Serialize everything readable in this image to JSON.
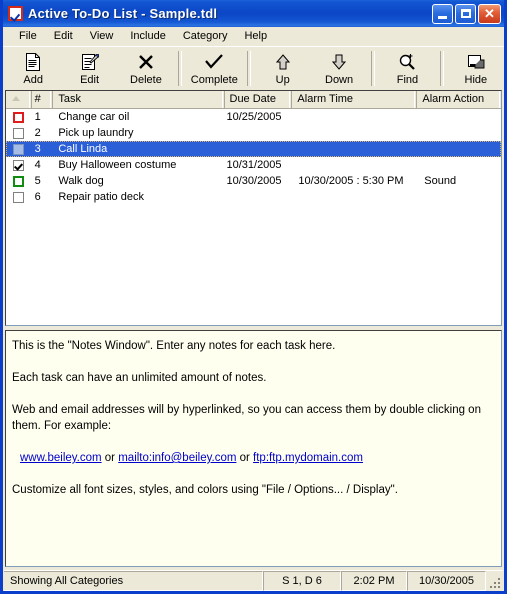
{
  "window": {
    "title": "Active To-Do List - Sample.tdl",
    "app_icon": "checkbox-icon",
    "controls": {
      "minimize_label": "",
      "maximize_label": "",
      "close_label": "✕"
    }
  },
  "menubar": {
    "items": [
      {
        "label": "File"
      },
      {
        "label": "Edit"
      },
      {
        "label": "View"
      },
      {
        "label": "Include"
      },
      {
        "label": "Category"
      },
      {
        "label": "Help"
      }
    ]
  },
  "toolbar": {
    "buttons": [
      {
        "label": "Add",
        "icon": "new-document-icon"
      },
      {
        "label": "Edit",
        "icon": "edit-document-icon"
      },
      {
        "label": "Delete",
        "icon": "x-cross-icon"
      },
      {
        "label": "Complete",
        "icon": "checkmark-icon"
      },
      {
        "label": "Up",
        "icon": "arrow-up-icon"
      },
      {
        "label": "Down",
        "icon": "arrow-down-icon"
      },
      {
        "label": "Find",
        "icon": "magnifier-icon"
      },
      {
        "label": "Hide",
        "icon": "window-minimize-icon"
      }
    ],
    "separator_after": [
      3,
      5,
      6
    ]
  },
  "task_list": {
    "columns": [
      {
        "key": "check",
        "label": "",
        "sort_indicator": "ascending"
      },
      {
        "key": "num",
        "label": "#"
      },
      {
        "key": "task",
        "label": "Task"
      },
      {
        "key": "due",
        "label": "Due Date"
      },
      {
        "key": "alarm",
        "label": "Alarm Time"
      },
      {
        "key": "action",
        "label": "Alarm Action"
      }
    ],
    "rows": [
      {
        "num": "1",
        "task": "Change car oil",
        "due": "10/25/2005",
        "alarm": "",
        "action": "",
        "checkbox": {
          "state": "unchecked",
          "color": "#e01b1b"
        },
        "selected": false
      },
      {
        "num": "2",
        "task": "Pick up laundry",
        "due": "",
        "alarm": "",
        "action": "",
        "checkbox": {
          "state": "unchecked",
          "color": "#808080"
        },
        "selected": false
      },
      {
        "num": "3",
        "task": "Call Linda",
        "due": "",
        "alarm": "",
        "action": "",
        "checkbox": {
          "state": "unchecked",
          "color": "#7a93c0"
        },
        "selected": true
      },
      {
        "num": "4",
        "task": "Buy Halloween costume",
        "due": "10/31/2005",
        "alarm": "",
        "action": "",
        "checkbox": {
          "state": "checked",
          "color": "#808080"
        },
        "selected": false
      },
      {
        "num": "5",
        "task": "Walk dog",
        "due": "10/30/2005",
        "alarm": "10/30/2005 : 5:30 PM",
        "action": "Sound",
        "checkbox": {
          "state": "unchecked",
          "color": "#108c10"
        },
        "selected": false
      },
      {
        "num": "6",
        "task": "Repair patio deck",
        "due": "",
        "alarm": "",
        "action": "",
        "checkbox": {
          "state": "unchecked",
          "color": "#808080"
        },
        "selected": false
      }
    ]
  },
  "notes": {
    "paragraph1": "This is the \"Notes Window\".  Enter any notes for each task here.",
    "paragraph2": "Each task can have an unlimited amount of notes.",
    "paragraph3": "Web and email addresses will by hyperlinked, so you can access them by double clicking on them.  For example:",
    "link1": "www.beiley.com",
    "separator1": " or ",
    "link2": "mailto:info@beiley.com",
    "separator2": " or ",
    "link3": "ftp:ftp.mydomain.com",
    "paragraph4": "Customize all font sizes, styles, and colors using \"File / Options... / Display\"."
  },
  "statusbar": {
    "message": "Showing All Categories",
    "counts": "S 1, D 6",
    "time": "2:02 PM",
    "date": "10/30/2005"
  },
  "colors": {
    "titlebar_blue": "#0b47c6",
    "window_border": "#0a3ecb",
    "selection_blue": "#2a5fd8",
    "face": "#ece9d8",
    "notes_bg": "#fffff0",
    "link": "#0000cc",
    "red_checkbox": "#e01b1b",
    "green_checkbox": "#108c10"
  }
}
